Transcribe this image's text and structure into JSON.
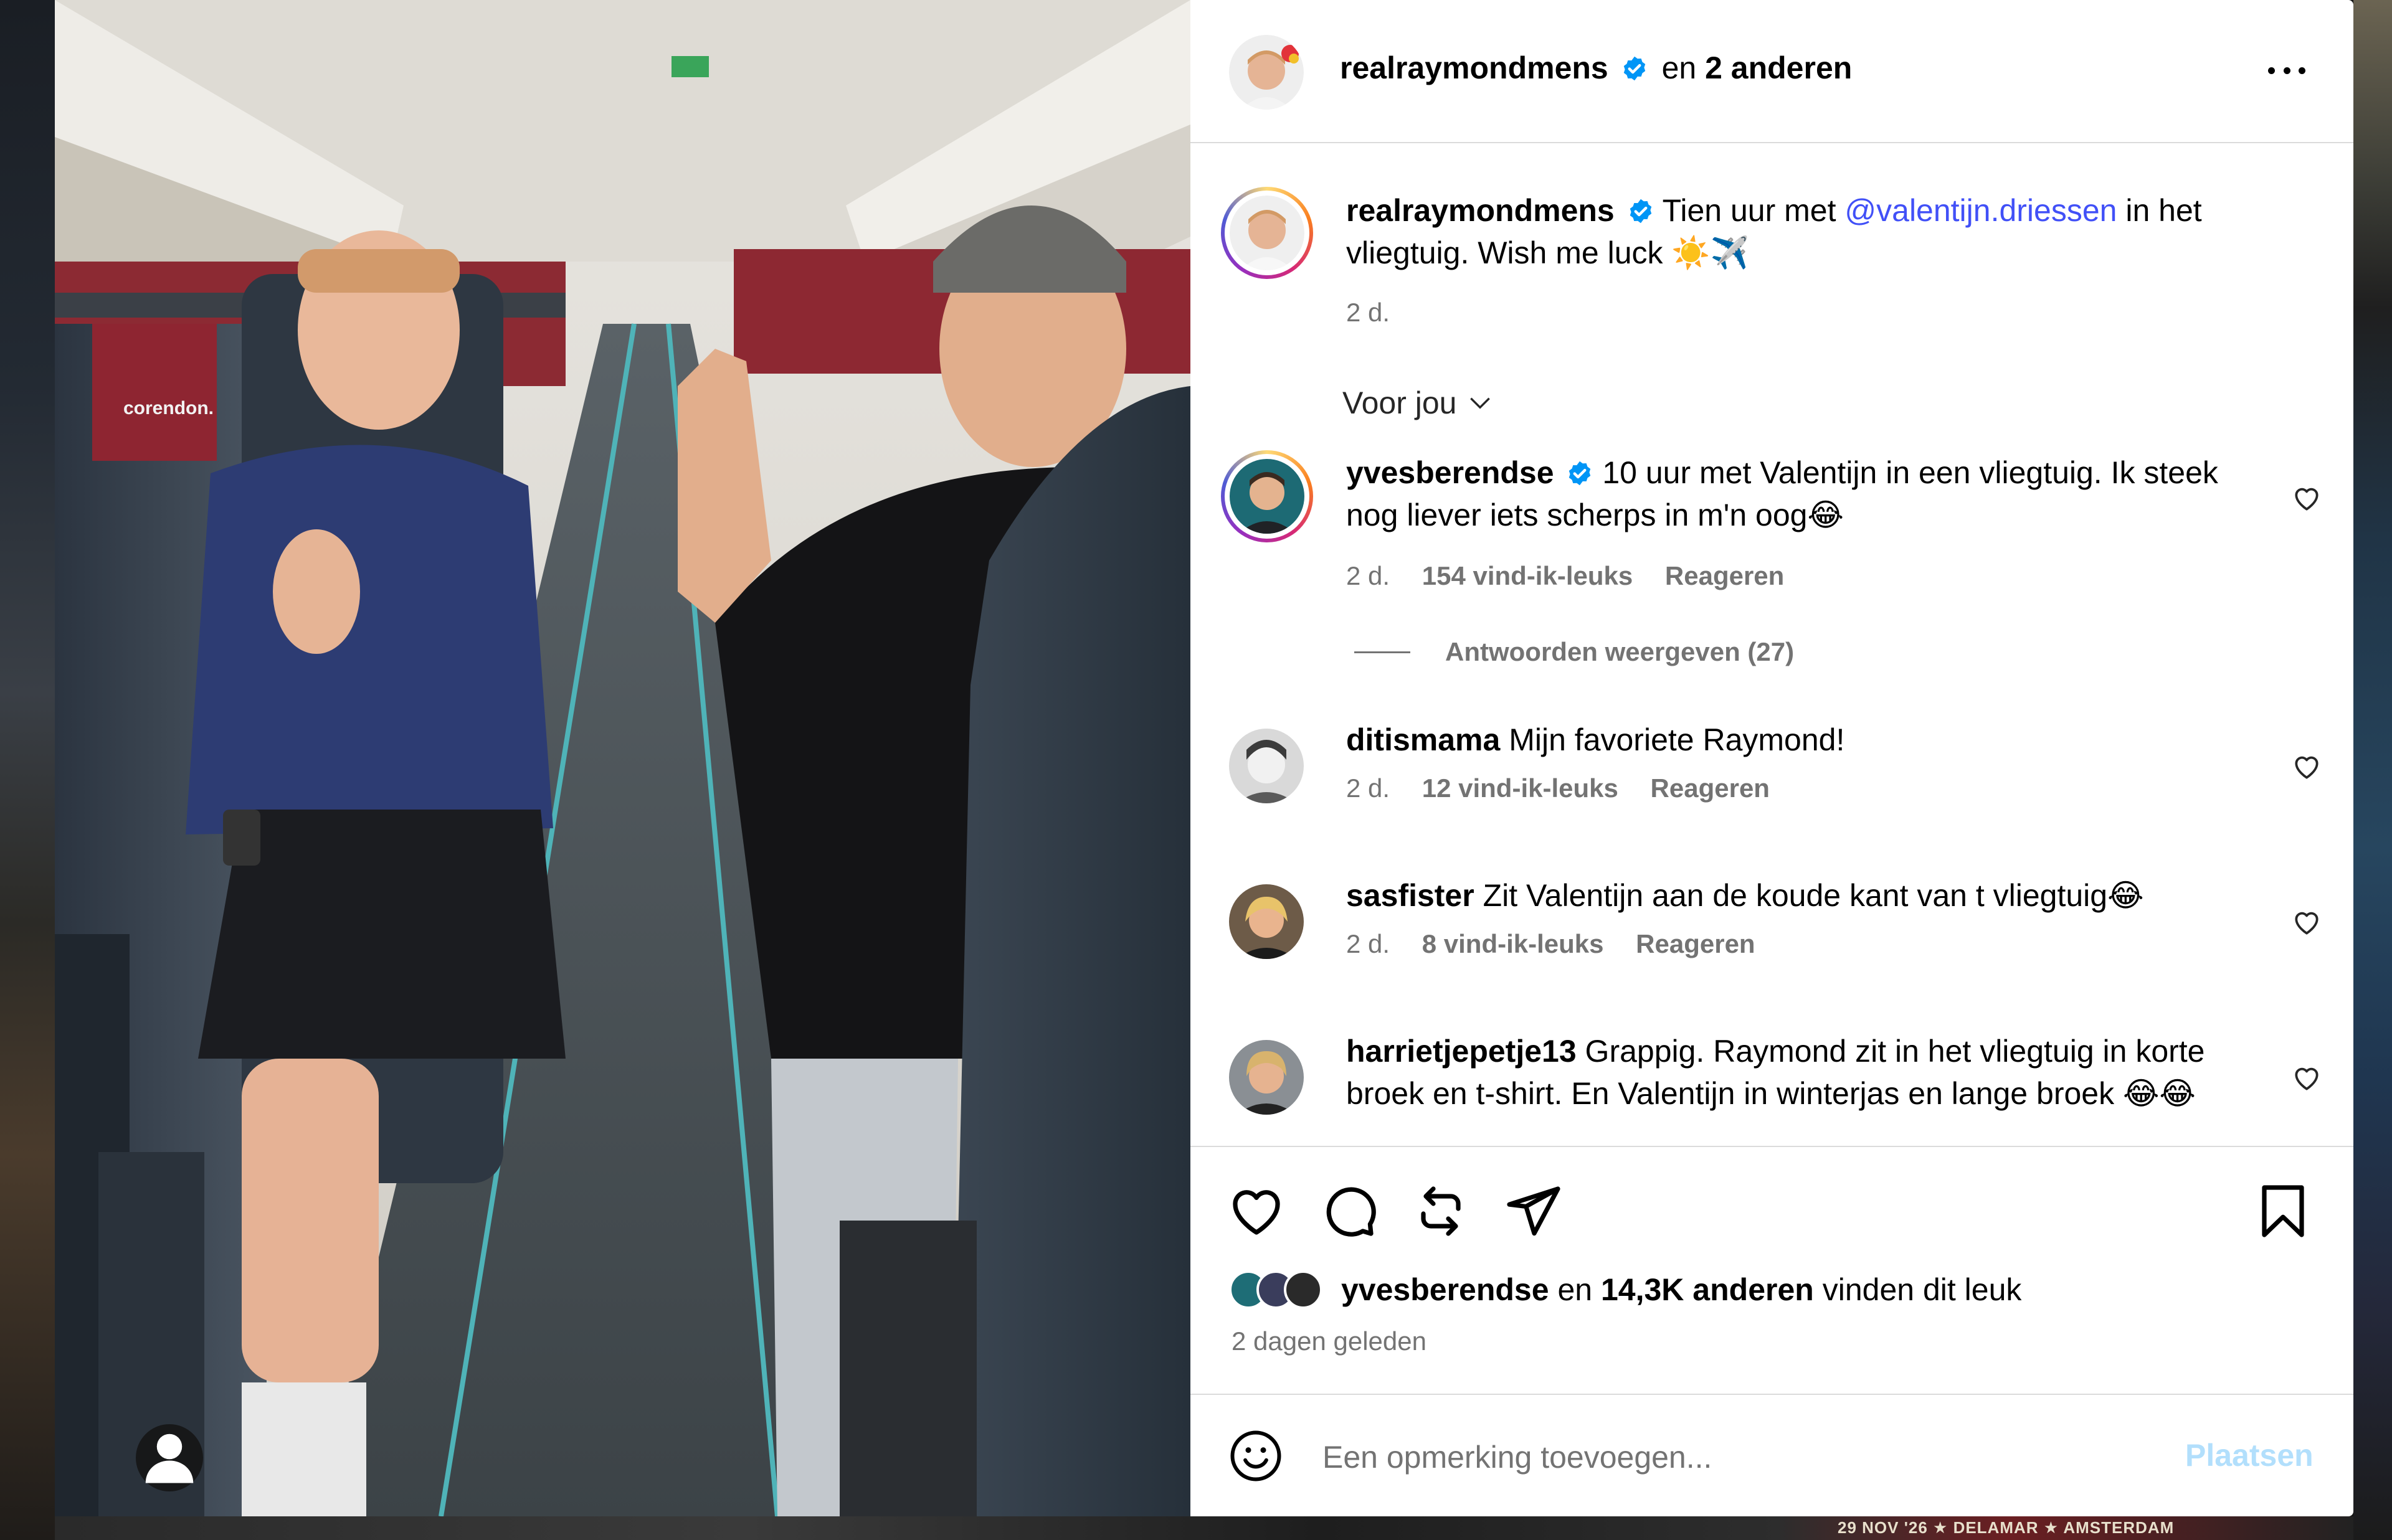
{
  "post": {
    "author": "realraymondmens",
    "coauthors_prefix": "en",
    "coauthors": "2 anderen"
  },
  "caption": {
    "username": "realraymondmens",
    "text_before": "Tien uur met",
    "mention": "@valentijn.driessen",
    "text_after": "in het vliegtuig. Wish me luck ☀️✈️",
    "time": "2 d."
  },
  "filter": {
    "label": "Voor jou"
  },
  "comments": [
    {
      "username": "yvesberendse",
      "verified": true,
      "text": "10 uur met Valentijn in een vliegtuig. Ik steek nog liever iets scherps in m'n oog😂",
      "time": "2 d.",
      "likes": "154 vind-ik-leuks",
      "reply": "Reageren",
      "view_replies": "Antwoorden weergeven (27)"
    },
    {
      "username": "ditismama",
      "verified": false,
      "text": "Mijn favoriete Raymond!",
      "time": "2 d.",
      "likes": "12 vind-ik-leuks",
      "reply": "Reageren"
    },
    {
      "username": "sasfister",
      "verified": false,
      "text": "Zit Valentijn aan de koude kant van t vliegtuig😂",
      "time": "2 d.",
      "likes": "8 vind-ik-leuks",
      "reply": "Reageren"
    },
    {
      "username": "harrietjepetje13",
      "verified": false,
      "text": "Grappig. Raymond zit in het vliegtuig in korte broek en t-shirt. En Valentijn in winterjas en lange broek 😂😂"
    }
  ],
  "likes_summary": {
    "first_user": "yvesberendse",
    "connector": "en",
    "count": "14,3K anderen",
    "suffix": "vinden dit leuk"
  },
  "post_date": "2 dagen geleden",
  "add_comment": {
    "placeholder": "Een opmerking toevoegen...",
    "submit": "Plaatsen"
  },
  "photo": {
    "seat_brand": "corendon."
  },
  "background": {
    "bottom_banner": "29 NOV '26 ★ DELAMAR ★ AMSTERDAM"
  },
  "colors": {
    "mention": "#4150f7",
    "verified": "#0095f6",
    "muted": "#737373",
    "post_button_disabled": "#b2dffc"
  },
  "icons": {
    "more": "more-horizontal-icon",
    "like": "heart-icon",
    "comment": "comment-icon",
    "repost": "repost-icon",
    "share": "paper-plane-icon",
    "save": "bookmark-icon",
    "emoji": "smiley-icon",
    "chevron": "chevron-down-icon",
    "user_tag": "user-tag-icon"
  }
}
